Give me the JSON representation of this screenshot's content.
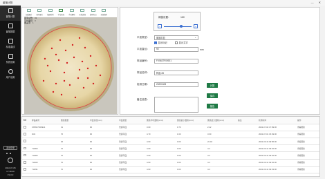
{
  "window": {
    "title": "菌落计数",
    "minimize": "—",
    "close": "✕"
  },
  "sidebar": {
    "items": [
      {
        "label": "菌落计数",
        "icon": "grid-icon"
      },
      {
        "label": "菌落数据",
        "icon": "database-icon"
      },
      {
        "label": "标准曲线",
        "icon": "curve-icon"
      },
      {
        "label": "系统设置",
        "icon": "settings-icon"
      },
      {
        "label": "用户设置",
        "icon": "user-icon"
      }
    ],
    "switch_label": "退出登录",
    "date": "2022-07-05",
    "time": "17:38:28",
    "version": "V1.0.0"
  },
  "toolbar": {
    "items": [
      "加载图片",
      "保存图片",
      "拍照检测",
      "手动添加",
      "手动删除",
      "区域选择",
      "清除标记",
      "全部清除"
    ]
  },
  "stats": {
    "count": "菌落总数：31",
    "area": "平均面积：3",
    "ratio": "覆盖率：1"
  },
  "threshold": {
    "label": "阈值设置：",
    "value": "160",
    "fraction": 0.63
  },
  "form": {
    "plate_type_label": "平皿类型：",
    "plate_type_value": "普通平皿",
    "check_marks_label": "显示标记",
    "check_text_label": "显示文字",
    "diameter_label": "平皿直径：",
    "diameter_value": "90",
    "diameter_unit": "mm",
    "sample_no_label": "样品编号：",
    "sample_no_value": "FX5637F00921",
    "sample_name_label": "样品名称：",
    "sample_name_value": "样品-35",
    "date_label": "检测日期：",
    "date_value": "20220423",
    "remark_label": "备注信息："
  },
  "buttons": {
    "count": "计数",
    "save": "保存",
    "report": "报告"
  },
  "table": {
    "headers": [
      "样品编号",
      "菌落数量",
      "平皿直径(mm)",
      "平皿类型",
      "菌落平均面积(mm²)",
      "菌落最小面积(mm²)",
      "菌落最大面积(mm²)",
      "备注",
      "检测时间",
      "操作"
    ],
    "rows": [
      [
        "FX5637F00921",
        "31",
        "90",
        "普通平皿",
        "3.00",
        "0.70",
        "2.22",
        "",
        "2022-07-02 17:09:30",
        "查看图片"
      ],
      [
        "D32",
        "76",
        "90",
        "普通平皿",
        "4.70",
        "1.60",
        "3.00",
        "",
        "2022-07-01 15:29:00",
        "查看图片"
      ],
      [
        "",
        "36",
        "90",
        "普通平皿",
        "4.60",
        "0.00",
        "22.04",
        "",
        "2022-06-16 09:56:00",
        "查看图片"
      ],
      [
        "YH903",
        "70",
        "90",
        "普通平皿",
        "4.60",
        "0.00",
        "4.4",
        "",
        "2022-06-14 09:32:00",
        "查看图片"
      ],
      [
        "YH905",
        "70",
        "90",
        "普通平皿",
        "4.60",
        "0.00",
        "4.4",
        "",
        "2022-06-14 09:32:00",
        "查看图片"
      ],
      [
        "YH923",
        "70",
        "90",
        "普通平皿",
        "4.60",
        "0.00",
        "4.4",
        "",
        "2022-06-14 09:32:00",
        "查看图片"
      ],
      [
        "YH931",
        "70",
        "90",
        "普通平皿",
        "4.60",
        "0.00",
        "4.4",
        "",
        "2022-06-14 09:33:00",
        "查看图片"
      ]
    ]
  }
}
